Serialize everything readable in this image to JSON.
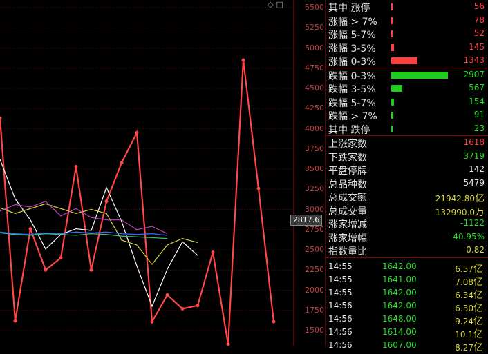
{
  "y_axis_ticks": [
    "5500",
    "5250",
    "5000",
    "4750",
    "4500",
    "4250",
    "4000",
    "3750",
    "3500",
    "3250",
    "3000",
    "2750",
    "2500",
    "2250",
    "2000",
    "1750",
    "1500"
  ],
  "cursor_value": "2817.6",
  "top_icons": [
    "diamond-icon",
    "square-icon"
  ],
  "rise_fall": [
    {
      "label": "其中 涨停",
      "value": "56",
      "type": "up",
      "bar": 56
    },
    {
      "label": "涨幅 > 7%",
      "value": "78",
      "type": "up",
      "bar": 78
    },
    {
      "label": "涨幅 5-7%",
      "value": "52",
      "type": "up",
      "bar": 52
    },
    {
      "label": "涨幅 3-5%",
      "value": "145",
      "type": "up",
      "bar": 145
    },
    {
      "label": "涨幅 0-3%",
      "value": "1343",
      "type": "up",
      "bar": 1343
    },
    {
      "label": "跌幅 0-3%",
      "value": "2907",
      "type": "down",
      "bar": 2907
    },
    {
      "label": "跌幅 3-5%",
      "value": "567",
      "type": "down",
      "bar": 567
    },
    {
      "label": "跌幅 5-7%",
      "value": "154",
      "type": "down",
      "bar": 154
    },
    {
      "label": "跌幅 > 7%",
      "value": "91",
      "type": "down",
      "bar": 91
    },
    {
      "label": "其中 跌停",
      "value": "23",
      "type": "down",
      "bar": 23
    }
  ],
  "stats": [
    {
      "label": "上涨家数",
      "value": "1618",
      "color": "red"
    },
    {
      "label": "下跌家数",
      "value": "3719",
      "color": "green"
    },
    {
      "label": "平盘停牌",
      "value": "142",
      "color": "white"
    },
    {
      "label": "总品种数",
      "value": "5479",
      "color": "white"
    },
    {
      "label": "总成交额",
      "value": "21942.80",
      "unit": "亿",
      "color": "yellow"
    },
    {
      "label": "总成交量",
      "value": "132990.0",
      "unit": "万",
      "color": "yellow"
    },
    {
      "label": "涨家增减",
      "value": "-1122",
      "color": "green"
    },
    {
      "label": "涨家增幅",
      "value": "-40.95%",
      "color": "green"
    },
    {
      "label": "指数量比",
      "value": "0.82",
      "color": "yellow"
    }
  ],
  "ticks": [
    {
      "time": "14:55",
      "price": "1642.00",
      "amount": "6.57",
      "unit": "亿"
    },
    {
      "time": "14:55",
      "price": "1641.00",
      "amount": "7.08",
      "unit": "亿"
    },
    {
      "time": "14:55",
      "price": "1642.00",
      "amount": "6.34",
      "unit": "亿"
    },
    {
      "time": "14:56",
      "price": "1642.00",
      "amount": "6.30",
      "unit": "亿"
    },
    {
      "time": "14:56",
      "price": "1648.00",
      "amount": "9.24",
      "unit": "亿"
    },
    {
      "time": "14:56",
      "price": "1614.00",
      "amount": "10.1",
      "unit": "亿"
    },
    {
      "time": "14:56",
      "price": "1607.00",
      "amount": "8.27",
      "unit": "亿"
    }
  ],
  "chart_data": {
    "type": "line",
    "ylim": [
      1500,
      5500
    ],
    "grid": true,
    "series": [
      {
        "color": "#ff4848",
        "values": [
          4130,
          1620,
          2760,
          2250,
          2400,
          3530,
          2250,
          3100,
          3580,
          3950,
          1610,
          1940,
          1770,
          1810,
          2470,
          1330,
          4850,
          3260,
          1610
        ]
      },
      {
        "color": "#ffffff",
        "values": [
          3620,
          3130,
          2870,
          2510,
          2690,
          2760,
          2740,
          3270,
          2850,
          2300,
          1800,
          2260,
          2600,
          2430
        ]
      },
      {
        "color": "#d8d840",
        "values": [
          3020,
          2950,
          3010,
          3070,
          3010,
          2950,
          3000,
          2950,
          2620,
          2560,
          2320,
          2560,
          2640,
          2590
        ]
      },
      {
        "color": "#c040c0",
        "values": [
          2980,
          3060,
          3030,
          3100,
          2920,
          3010,
          2900,
          2870,
          2870,
          2750,
          2790,
          2700
        ]
      },
      {
        "color": "#3a6aff",
        "values": [
          2720,
          2700,
          2690,
          2710,
          2700,
          2720,
          2710,
          2720,
          2700,
          2690,
          2700,
          2680
        ]
      },
      {
        "color": "#40c080",
        "values": [
          2710,
          2690,
          2680,
          2700,
          2690,
          2680,
          2700,
          2690,
          2670,
          2660,
          2650,
          2640
        ]
      }
    ]
  }
}
